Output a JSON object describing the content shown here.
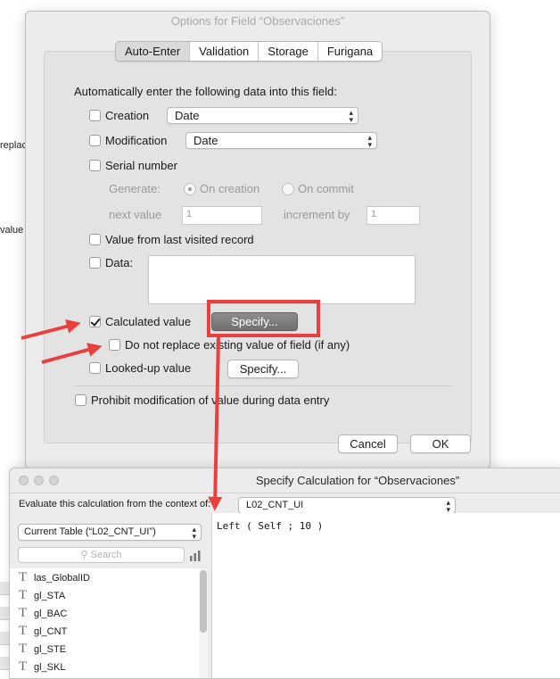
{
  "background": {
    "fragment_1": "replac",
    "fragment_2": "value"
  },
  "options_dialog": {
    "title": "Options for Field “Observaciones”",
    "tabs": [
      "Auto-Enter",
      "Validation",
      "Storage",
      "Furigana"
    ],
    "selected_tab": "Auto-Enter",
    "heading": "Automatically enter the following data into this field:",
    "creation": {
      "label": "Creation",
      "checked": false,
      "value": "Date"
    },
    "modification": {
      "label": "Modification",
      "checked": false,
      "value": "Date"
    },
    "serial_number": {
      "label": "Serial number",
      "generate_label": "Generate:",
      "on_creation": "On creation",
      "on_commit": "On commit",
      "next_value_label": "next value",
      "next_value": "1",
      "increment_label": "increment by",
      "increment": "1"
    },
    "last_visited": {
      "label": "Value from last visited record"
    },
    "data": {
      "label": "Data:"
    },
    "calculated": {
      "label": "Calculated value",
      "checked": true,
      "specify_label": "Specify..."
    },
    "do_not_replace": {
      "label": "Do not replace existing value of field (if any)"
    },
    "looked_up": {
      "label": "Looked-up value",
      "specify_label": "Specify..."
    },
    "prohibit": {
      "label": "Prohibit modification of value during data entry"
    },
    "cancel_label": "Cancel",
    "ok_label": "OK"
  },
  "annotation": {
    "color": "#e8403f"
  },
  "calc_window": {
    "title": "Specify Calculation for “Observaciones”",
    "context_label": "Evaluate this calculation from the context of:",
    "context_value": "L02_CNT_UI",
    "table_select": "Current Table (“L02_CNT_UI”)",
    "search_placeholder": "Search",
    "fields": [
      "las_GlobalID",
      "gl_STA",
      "gl_BAC",
      "gl_CNT",
      "gl_STE",
      "gl_SKL"
    ],
    "formula": "Left ( Self ; 10 )"
  }
}
